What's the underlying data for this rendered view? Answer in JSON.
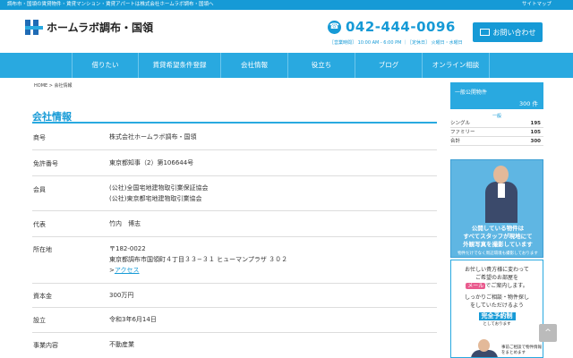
{
  "topbar": {
    "tagline": "調布市・国領の賃貸物件・賃貸マンション・賃貸アパートは株式会社ホームラボ調布・国領へ",
    "sitemap": "サイトマップ"
  },
  "header": {
    "logo_text": "ホームラボ調布・国領",
    "phone": "042-444-0096",
    "hours": "［営業時間］ 10:00 AM - 6:00 PM ｜［定休日］ 火曜日・水曜日",
    "contact_label": "お問い合わせ"
  },
  "nav": {
    "items": [
      "借りたい",
      "賃貸希望条件登録",
      "会社情報",
      "役立ち",
      "ブログ",
      "オンライン相談"
    ]
  },
  "breadcrumb": "HOME > 会社情報",
  "page_title": "会社情報",
  "company": {
    "rows": [
      {
        "key": "商号",
        "lines": [
          "株式会社ホームラボ調布・国領"
        ]
      },
      {
        "key": "免許番号",
        "lines": [
          "東京都知事（2）第106644号"
        ]
      },
      {
        "key": "会員",
        "lines": [
          "(公社)全国宅地建物取引業保証協会",
          "(公社)東京都宅地建物取引業協会"
        ]
      },
      {
        "key": "代表",
        "lines": [
          "竹内　博志"
        ]
      },
      {
        "key": "所在地",
        "lines": [
          "〒182-0022",
          "東京都調布市国領町４丁目３３−３１ ヒューマンプラザ ３０２"
        ],
        "link": "アクセス",
        "link_prefix": ">"
      },
      {
        "key": "資本金",
        "lines": [
          "300万円"
        ]
      },
      {
        "key": "設立",
        "lines": [
          "令和3年6月14日"
        ]
      },
      {
        "key": "事業内容",
        "lines": [
          "不動産業"
        ]
      }
    ]
  },
  "sidebar": {
    "title": "一般公開物件",
    "count": "300 件",
    "link": "一般",
    "rows": [
      {
        "label": "シングル",
        "value": "195"
      },
      {
        "label": "ファミリー",
        "value": "105"
      },
      {
        "label": "合計",
        "value": "300"
      }
    ],
    "banner1": {
      "line1": "公開している物件は",
      "line2": "すべてスタッフが現地にて",
      "line3": "外観写真を撮影しています",
      "small": "物件だけでなく周辺環境も撮影しております"
    },
    "banner2": {
      "line1": "お忙しい貴方様に変わって",
      "line2": "ご希望のお部屋を",
      "mail": "メール",
      "line3": "でご案内します。",
      "line4": "しっかりご相談・物件探し",
      "line5": "をしていただけるよう",
      "kanzen": "完全予約制",
      "small": "としております",
      "tiny": "事前ご相談で物件情報をまとめます"
    }
  },
  "totop": "^"
}
